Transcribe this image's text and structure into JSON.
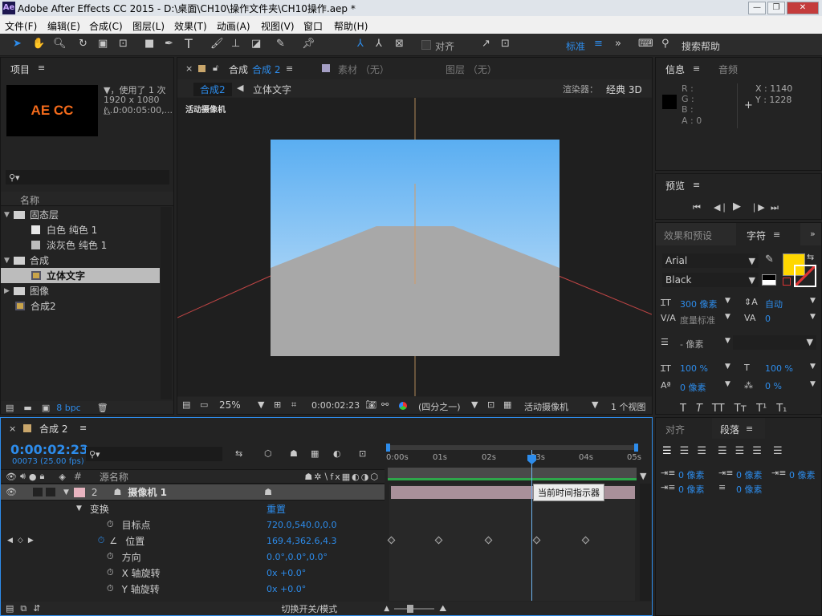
{
  "titlebar": {
    "logo": "Ae",
    "title": "Adobe After Effects CC 2015 - D:\\桌面\\CH10\\操作文件夹\\CH10操作.aep *"
  },
  "menu": [
    "文件(F)",
    "编辑(E)",
    "合成(C)",
    "图层(L)",
    "效果(T)",
    "动画(A)",
    "视图(V)",
    "窗口",
    "帮助(H)"
  ],
  "toolbar": {
    "align_label": "对齐",
    "workspace": "标准",
    "search": "搜索帮助"
  },
  "project": {
    "tab": "项目",
    "thumb_text": "AE CC",
    "info_line1": "▼，使用了 1 次",
    "info_line2": "1920 x 1080 (...",
    "info_line3": "△ 0:00:05:00,...",
    "col_name": "名称",
    "items": [
      {
        "label": "固态层",
        "type": "folder",
        "indent": 0
      },
      {
        "label": "白色 纯色 1",
        "type": "solid",
        "indent": 1
      },
      {
        "label": "淡灰色 纯色 1",
        "type": "solid",
        "indent": 1
      },
      {
        "label": "合成",
        "type": "folder",
        "indent": 0
      },
      {
        "label": "立体文字",
        "type": "comp",
        "indent": 1,
        "selected": true
      },
      {
        "label": "图像",
        "type": "folder",
        "indent": 0
      },
      {
        "label": "合成2",
        "type": "comp",
        "indent": 0
      }
    ],
    "bpc": "8 bpc"
  },
  "comp": {
    "tab_prefix": "合成",
    "tab_name": "合成 2",
    "footage_tab": "素材 （无）",
    "layer_tab": "图层 （无）",
    "crumb_active": "合成2",
    "crumb_next": "立体文字",
    "renderer_label": "渲染器：",
    "renderer": "经典 3D",
    "camera_label": "活动摄像机",
    "zoom": "25%",
    "timecode": "0:00:02:23",
    "resolution": "(四分之一)",
    "view": "活动摄像机",
    "views": "1 个视图"
  },
  "info": {
    "tab": "信息",
    "audio_tab": "音频",
    "r": "R :",
    "g": "G :",
    "b": "B :",
    "a": "A : 0",
    "x": "X : 1140",
    "y": "Y : 1228"
  },
  "preview": {
    "tab": "预览"
  },
  "effects_tab": "效果和预设",
  "character": {
    "tab": "字符",
    "font": "Arial",
    "style": "Black",
    "size": "300 像素",
    "leading": "自动",
    "kerning": "度量标准",
    "tracking": "0",
    "stroke": "- 像素",
    "vscale": "100 %",
    "hscale": "100 %",
    "baseline": "0 像素",
    "tsume": "0 %",
    "fill_color": "#ffd700"
  },
  "paragraph": {
    "align_tab": "对齐",
    "tab": "段落",
    "indent_left": "0 像素",
    "indent_first": "0 像素",
    "indent_right": "0 像素",
    "space_before": "0 像素",
    "space_after": "0 像素"
  },
  "timeline": {
    "tab": "合成 2",
    "timecode": "0:00:02:23",
    "frames": "00073 (25.00 fps)",
    "col_num": "#",
    "col_source": "源名称",
    "ticks": [
      "0:00s",
      "01s",
      "02s",
      "03s",
      "04s",
      "05s"
    ],
    "tooltip": "当前时间指示器",
    "bottom_label": "切换开关/模式",
    "layers": [
      {
        "num": "2",
        "name": "摄像机 1",
        "level": 0
      },
      {
        "name": "变换",
        "level": 1,
        "value": "重置"
      },
      {
        "name": "目标点",
        "level": 2,
        "value": "720.0,540.0,0.0"
      },
      {
        "name": "位置",
        "level": 2,
        "value": "169.4,362.6,4.3"
      },
      {
        "name": "方向",
        "level": 2,
        "value": "0.0°,0.0°,0.0°"
      },
      {
        "name": "X 轴旋转",
        "level": 2,
        "value": "0x +0.0°"
      },
      {
        "name": "Y 轴旋转",
        "level": 2,
        "value": "0x +0.0°"
      }
    ]
  }
}
